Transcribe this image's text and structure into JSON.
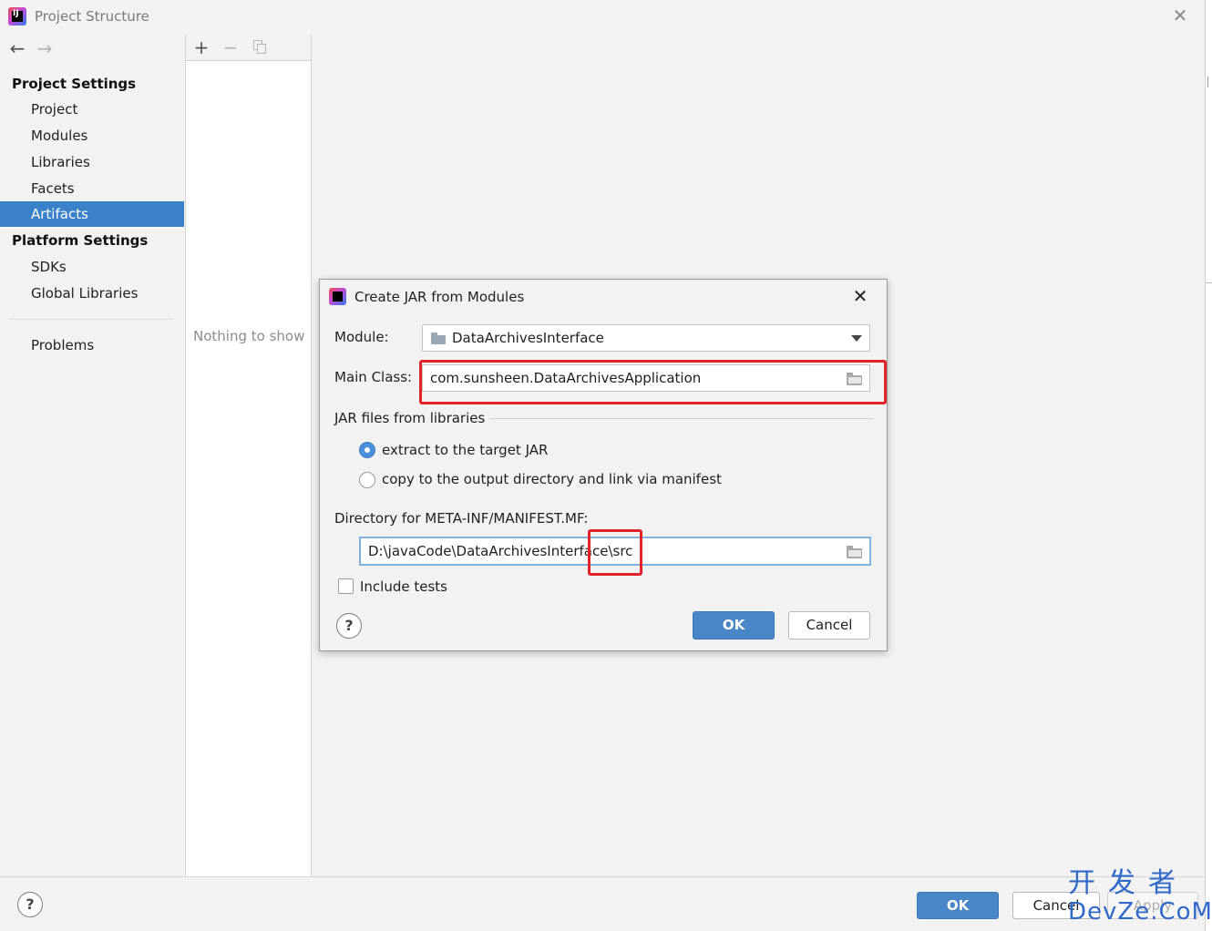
{
  "window": {
    "title": "Project Structure",
    "close_symbol": "✕"
  },
  "nav": {
    "back_symbol": "←",
    "forward_symbol": "→"
  },
  "sidebar": {
    "project_settings_header": "Project Settings",
    "project_items": [
      {
        "label": "Project"
      },
      {
        "label": "Modules"
      },
      {
        "label": "Libraries"
      },
      {
        "label": "Facets"
      },
      {
        "label": "Artifacts",
        "selected": true
      }
    ],
    "platform_settings_header": "Platform Settings",
    "platform_items": [
      {
        "label": "SDKs"
      },
      {
        "label": "Global Libraries"
      }
    ],
    "problems_label": "Problems"
  },
  "list_panel": {
    "add_symbol": "+",
    "remove_symbol": "−",
    "empty_text": "Nothing to show"
  },
  "dialog": {
    "title": "Create JAR from Modules",
    "close_symbol": "✕",
    "module_label": "Module:",
    "module_value": "DataArchivesInterface",
    "main_class_label": "Main Class:",
    "main_class_value": "com.sunsheen.DataArchivesApplication",
    "jar_group_label": "JAR files from libraries",
    "radio_extract_label": "extract to the target JAR",
    "radio_copy_label": "copy to the output directory and link via manifest",
    "radio_selected": "extract",
    "manifest_label": "Directory for META-INF/MANIFEST.MF:",
    "manifest_value": "D:\\javaCode\\DataArchivesInterface\\src",
    "include_tests_label": "Include tests",
    "include_tests_checked": false,
    "help_symbol": "?",
    "ok_label": "OK",
    "cancel_label": "Cancel"
  },
  "bottom": {
    "help_symbol": "?",
    "ok_label": "OK",
    "cancel_label": "Cancel",
    "apply_label": "Apply"
  },
  "watermark": {
    "line1": "开发者",
    "line2": "DevZe.CoM"
  },
  "colors": {
    "selection": "#3a81c9",
    "primary_button": "#4a87c8",
    "highlight_box": "#e0242a",
    "watermark": "#2f69c9"
  },
  "icons": [
    "app-logo-icon",
    "back-arrow-icon",
    "forward-arrow-icon",
    "add-icon",
    "remove-icon",
    "copy-icon",
    "module-folder-icon",
    "dropdown-arrow-icon",
    "browse-folder-icon",
    "help-icon"
  ]
}
